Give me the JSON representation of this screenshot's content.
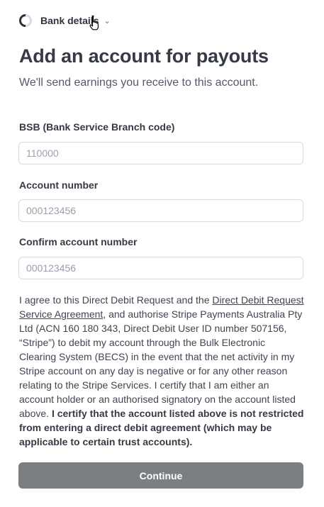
{
  "header": {
    "step_label": "Bank details",
    "chevron": "chevron-down-icon",
    "progress_icon": "progress-ring-icon"
  },
  "page": {
    "title": "Add an account for payouts",
    "subtitle": "We'll send earnings you receive to this account."
  },
  "form": {
    "bsb": {
      "label": "BSB (Bank Service Branch code)",
      "placeholder": "110000"
    },
    "account_number": {
      "label": "Account number",
      "placeholder": "000123456"
    },
    "confirm_account_number": {
      "label": "Confirm account number",
      "placeholder": "000123456"
    }
  },
  "mandate": {
    "text_1": "I agree to this Direct Debit Request and the ",
    "link": "Direct Debit Request Service Agreement",
    "text_2": ", and authorise Stripe Payments Australia Pty Ltd (ACN 160 180 343, Direct Debit User ID number 507156, “Stripe”) to debit my account through the Bulk Electronic Clearing System (BECS) in the event that the net activity in my Stripe account on any day is negative or for any other reason relating to the Stripe Services. I certify that I am either an account holder or an authorised signatory on the account listed above. ",
    "bold": "I certify that the account listed above is not restricted from entering a direct debit agreement (which may be applicable to certain trust accounts)."
  },
  "actions": {
    "continue_label": "Continue"
  },
  "colors": {
    "button_disabled": "#7c7f82",
    "progress_dark": "#30313d",
    "progress_light": "#d5dbe1"
  }
}
